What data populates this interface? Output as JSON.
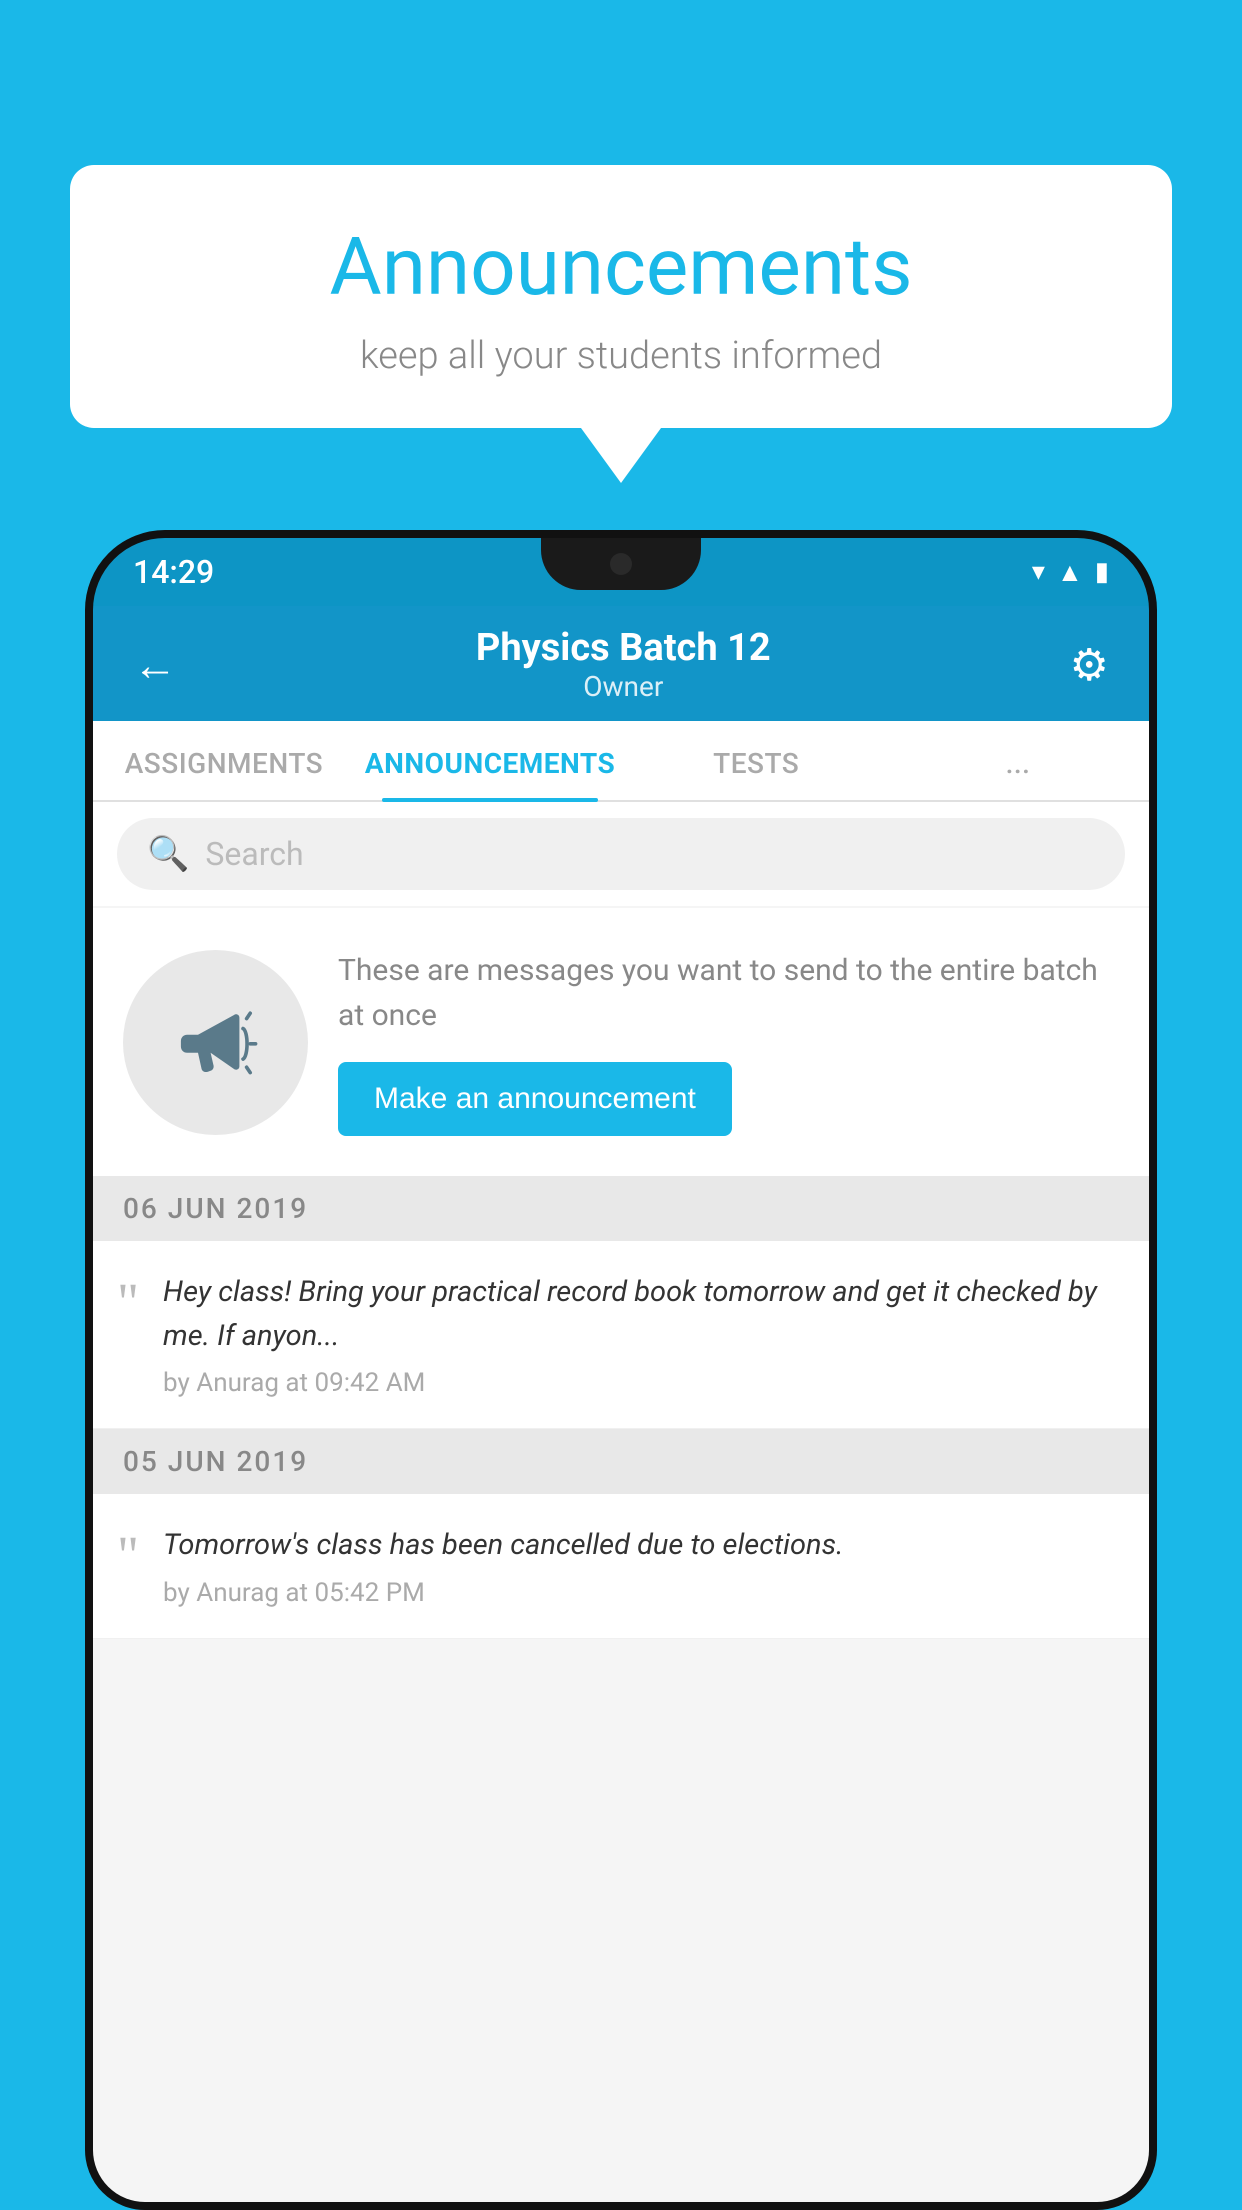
{
  "background_color": "#1ab8e8",
  "speech_bubble": {
    "title": "Announcements",
    "subtitle": "keep all your students informed"
  },
  "status_bar": {
    "time": "14:29",
    "icons": [
      "wifi",
      "signal",
      "battery"
    ]
  },
  "app_header": {
    "back_label": "←",
    "title": "Physics Batch 12",
    "subtitle": "Owner",
    "settings_label": "⚙"
  },
  "tabs": [
    {
      "label": "ASSIGNMENTS",
      "active": false
    },
    {
      "label": "ANNOUNCEMENTS",
      "active": true
    },
    {
      "label": "TESTS",
      "active": false
    },
    {
      "label": "...",
      "active": false
    }
  ],
  "search": {
    "placeholder": "Search"
  },
  "announcement_promo": {
    "description": "These are messages you want to send to the entire batch at once",
    "button_label": "Make an announcement"
  },
  "date_groups": [
    {
      "date": "06  JUN  2019",
      "items": [
        {
          "text": "Hey class! Bring your practical record book tomorrow and get it checked by me. If anyon...",
          "meta": "by Anurag at 09:42 AM"
        }
      ]
    },
    {
      "date": "05  JUN  2019",
      "items": [
        {
          "text": "Tomorrow's class has been cancelled due to elections.",
          "meta": "by Anurag at 05:42 PM"
        }
      ]
    }
  ]
}
